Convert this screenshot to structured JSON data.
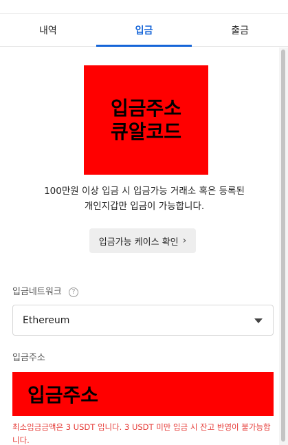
{
  "tabs": [
    {
      "label": "내역",
      "active": false
    },
    {
      "label": "입금",
      "active": true
    },
    {
      "label": "출금",
      "active": false
    }
  ],
  "qr": {
    "text": "입금주소\n큐알코드"
  },
  "notice": "100만원 이상 입금 시 입금가능 거래소 혹은 등록된\n개인지갑만 입금이 가능합니다.",
  "case_button": {
    "label": "입금가능 케이스 확인",
    "chevron": "›"
  },
  "network": {
    "label": "입금네트워크",
    "help": "?",
    "selected": "Ethereum"
  },
  "address": {
    "label": "입금주소",
    "value": "입금주소"
  },
  "warning": "최소입금금액은 3 USDT 입니다. 3 USDT 미만 입금 시 잔고 반영이 불가능합니다.",
  "colors": {
    "accent": "#1565d8",
    "placeholder_red": "#ff0000",
    "warning": "#e53935"
  },
  "icons": {
    "help": "help-circle-icon",
    "caret": "caret-down-icon",
    "chevron": "chevron-right-icon"
  }
}
